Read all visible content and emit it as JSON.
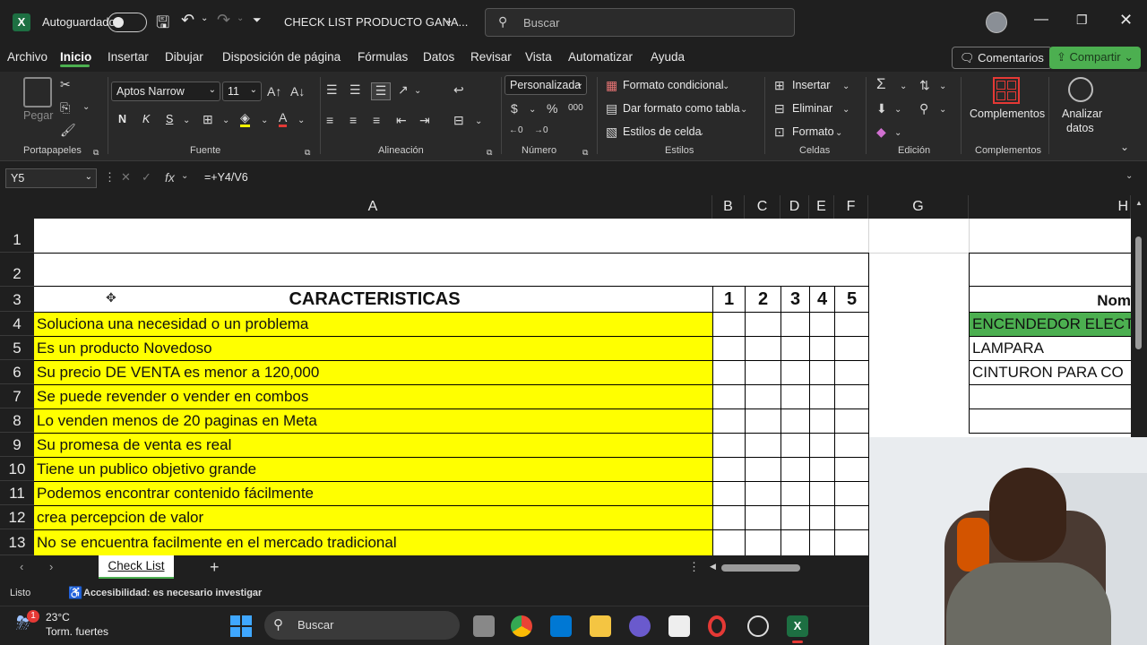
{
  "titlebar": {
    "autosave_label": "Autoguardado",
    "file_title": "CHECK LIST PRODUCTO GANA...",
    "search_placeholder": "Buscar"
  },
  "menu": {
    "items": [
      "Archivo",
      "Inicio",
      "Insertar",
      "Dibujar",
      "Disposición de página",
      "Fórmulas",
      "Datos",
      "Revisar",
      "Vista",
      "Automatizar",
      "Ayuda"
    ],
    "active": "Inicio",
    "comments_label": "Comentarios",
    "share_label": "Compartir"
  },
  "ribbon": {
    "clipboard": {
      "paste_label": "Pegar",
      "group_label": "Portapapeles"
    },
    "font": {
      "name": "Aptos Narrow",
      "size": "11",
      "group_label": "Fuente",
      "bold": "N",
      "italic": "K",
      "underline": "S"
    },
    "alignment": {
      "group_label": "Alineación"
    },
    "number": {
      "format": "Personalizada",
      "group_label": "Número"
    },
    "styles": {
      "conditional": "Formato condicional",
      "as_table": "Dar formato como tabla",
      "cell_styles": "Estilos de celda",
      "group_label": "Estilos"
    },
    "cells": {
      "insert": "Insertar",
      "delete": "Eliminar",
      "format": "Formato",
      "group_label": "Celdas"
    },
    "editing": {
      "group_label": "Edición"
    },
    "addins": {
      "label": "Complementos",
      "group_label": "Complementos"
    },
    "analyze": {
      "label_1": "Analizar",
      "label_2": "datos"
    }
  },
  "formula_bar": {
    "cell_ref": "Y5",
    "fx": "fx",
    "formula": "=+Y4/V6"
  },
  "grid": {
    "columns": [
      "A",
      "B",
      "C",
      "D",
      "E",
      "F",
      "G",
      "H"
    ],
    "rows": [
      "1",
      "2",
      "3",
      "4",
      "5",
      "6",
      "7",
      "8",
      "9",
      "10",
      "11",
      "12",
      "13"
    ],
    "header_title": "CARACTERISTICAS",
    "score_headers": [
      "1",
      "2",
      "3",
      "4",
      "5"
    ],
    "name_header": "Nom",
    "characteristics": [
      "Soluciona una necesidad o un problema",
      "Es un producto Novedoso",
      "Su precio DE VENTA es menor a 120,000",
      "Se puede revender o vender en combos",
      "Lo venden menos de 20 paginas en Meta",
      "Su promesa de venta es real",
      "Tiene un publico objetivo grande",
      "Podemos encontrar contenido fácilmente",
      "crea percepcion de valor",
      "No se encuentra facilmente en el mercado tradicional"
    ],
    "products": [
      "ENCENDEDOR ELECT",
      "LAMPARA",
      "CINTURON PARA CO"
    ]
  },
  "sheet_tabs": {
    "active": "Check List",
    "add": "+"
  },
  "status": {
    "ready": "Listo",
    "accessibility": "Accesibilidad: es necesario investigar"
  },
  "taskbar": {
    "temp": "23°C",
    "weather": "Torm. fuertes",
    "search": "Buscar",
    "badge": "1"
  },
  "colors": {
    "yellow": "#ffff00",
    "green": "#4caf50",
    "accent": "#4caf50"
  }
}
